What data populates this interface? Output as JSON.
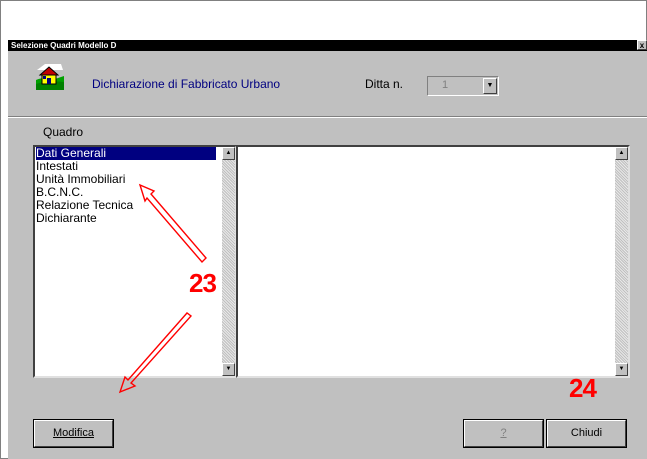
{
  "window": {
    "title": "Selezione Quadri Modello D",
    "close_glyph": "x"
  },
  "header": {
    "icon": "house-icon",
    "form_title": "Dichiarazione di Fabbricato Urbano",
    "ditta_label": "Ditta n.",
    "ditta_value": "1"
  },
  "quadro": {
    "label": "Quadro",
    "items": [
      {
        "label": "Dati Generali",
        "selected": true
      },
      {
        "label": "Intestati",
        "selected": false
      },
      {
        "label": "Unità Immobiliari",
        "selected": false
      },
      {
        "label": "B.C.N.C.",
        "selected": false
      },
      {
        "label": "Relazione Tecnica",
        "selected": false
      },
      {
        "label": "Dichiarante",
        "selected": false
      }
    ]
  },
  "buttons": {
    "modifica": "Modifica",
    "help": "?",
    "chiudi": "Chiudi"
  },
  "annotations": {
    "callout_1": "23",
    "callout_2": "24",
    "color": "#ff0000"
  },
  "colors": {
    "selection": "#000080",
    "title_text": "#000080",
    "dialog_bg": "#c0c0c0"
  }
}
